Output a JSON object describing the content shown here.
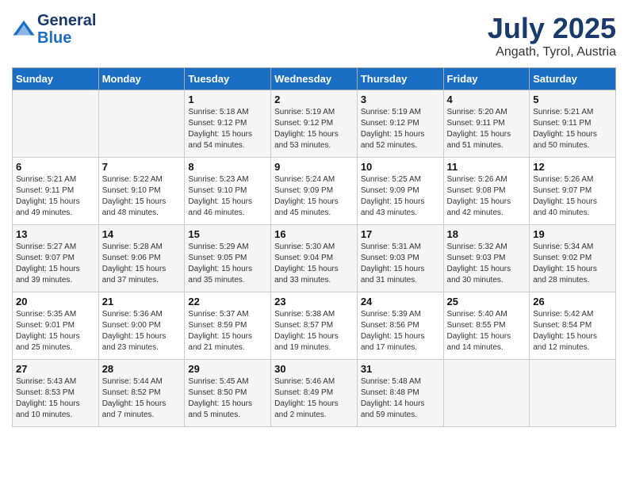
{
  "header": {
    "logo_line1": "General",
    "logo_line2": "Blue",
    "month": "July 2025",
    "location": "Angath, Tyrol, Austria"
  },
  "days_of_week": [
    "Sunday",
    "Monday",
    "Tuesday",
    "Wednesday",
    "Thursday",
    "Friday",
    "Saturday"
  ],
  "weeks": [
    [
      {
        "day": "",
        "info": ""
      },
      {
        "day": "",
        "info": ""
      },
      {
        "day": "1",
        "info": "Sunrise: 5:18 AM\nSunset: 9:12 PM\nDaylight: 15 hours and 54 minutes."
      },
      {
        "day": "2",
        "info": "Sunrise: 5:19 AM\nSunset: 9:12 PM\nDaylight: 15 hours and 53 minutes."
      },
      {
        "day": "3",
        "info": "Sunrise: 5:19 AM\nSunset: 9:12 PM\nDaylight: 15 hours and 52 minutes."
      },
      {
        "day": "4",
        "info": "Sunrise: 5:20 AM\nSunset: 9:11 PM\nDaylight: 15 hours and 51 minutes."
      },
      {
        "day": "5",
        "info": "Sunrise: 5:21 AM\nSunset: 9:11 PM\nDaylight: 15 hours and 50 minutes."
      }
    ],
    [
      {
        "day": "6",
        "info": "Sunrise: 5:21 AM\nSunset: 9:11 PM\nDaylight: 15 hours and 49 minutes."
      },
      {
        "day": "7",
        "info": "Sunrise: 5:22 AM\nSunset: 9:10 PM\nDaylight: 15 hours and 48 minutes."
      },
      {
        "day": "8",
        "info": "Sunrise: 5:23 AM\nSunset: 9:10 PM\nDaylight: 15 hours and 46 minutes."
      },
      {
        "day": "9",
        "info": "Sunrise: 5:24 AM\nSunset: 9:09 PM\nDaylight: 15 hours and 45 minutes."
      },
      {
        "day": "10",
        "info": "Sunrise: 5:25 AM\nSunset: 9:09 PM\nDaylight: 15 hours and 43 minutes."
      },
      {
        "day": "11",
        "info": "Sunrise: 5:26 AM\nSunset: 9:08 PM\nDaylight: 15 hours and 42 minutes."
      },
      {
        "day": "12",
        "info": "Sunrise: 5:26 AM\nSunset: 9:07 PM\nDaylight: 15 hours and 40 minutes."
      }
    ],
    [
      {
        "day": "13",
        "info": "Sunrise: 5:27 AM\nSunset: 9:07 PM\nDaylight: 15 hours and 39 minutes."
      },
      {
        "day": "14",
        "info": "Sunrise: 5:28 AM\nSunset: 9:06 PM\nDaylight: 15 hours and 37 minutes."
      },
      {
        "day": "15",
        "info": "Sunrise: 5:29 AM\nSunset: 9:05 PM\nDaylight: 15 hours and 35 minutes."
      },
      {
        "day": "16",
        "info": "Sunrise: 5:30 AM\nSunset: 9:04 PM\nDaylight: 15 hours and 33 minutes."
      },
      {
        "day": "17",
        "info": "Sunrise: 5:31 AM\nSunset: 9:03 PM\nDaylight: 15 hours and 31 minutes."
      },
      {
        "day": "18",
        "info": "Sunrise: 5:32 AM\nSunset: 9:03 PM\nDaylight: 15 hours and 30 minutes."
      },
      {
        "day": "19",
        "info": "Sunrise: 5:34 AM\nSunset: 9:02 PM\nDaylight: 15 hours and 28 minutes."
      }
    ],
    [
      {
        "day": "20",
        "info": "Sunrise: 5:35 AM\nSunset: 9:01 PM\nDaylight: 15 hours and 25 minutes."
      },
      {
        "day": "21",
        "info": "Sunrise: 5:36 AM\nSunset: 9:00 PM\nDaylight: 15 hours and 23 minutes."
      },
      {
        "day": "22",
        "info": "Sunrise: 5:37 AM\nSunset: 8:59 PM\nDaylight: 15 hours and 21 minutes."
      },
      {
        "day": "23",
        "info": "Sunrise: 5:38 AM\nSunset: 8:57 PM\nDaylight: 15 hours and 19 minutes."
      },
      {
        "day": "24",
        "info": "Sunrise: 5:39 AM\nSunset: 8:56 PM\nDaylight: 15 hours and 17 minutes."
      },
      {
        "day": "25",
        "info": "Sunrise: 5:40 AM\nSunset: 8:55 PM\nDaylight: 15 hours and 14 minutes."
      },
      {
        "day": "26",
        "info": "Sunrise: 5:42 AM\nSunset: 8:54 PM\nDaylight: 15 hours and 12 minutes."
      }
    ],
    [
      {
        "day": "27",
        "info": "Sunrise: 5:43 AM\nSunset: 8:53 PM\nDaylight: 15 hours and 10 minutes."
      },
      {
        "day": "28",
        "info": "Sunrise: 5:44 AM\nSunset: 8:52 PM\nDaylight: 15 hours and 7 minutes."
      },
      {
        "day": "29",
        "info": "Sunrise: 5:45 AM\nSunset: 8:50 PM\nDaylight: 15 hours and 5 minutes."
      },
      {
        "day": "30",
        "info": "Sunrise: 5:46 AM\nSunset: 8:49 PM\nDaylight: 15 hours and 2 minutes."
      },
      {
        "day": "31",
        "info": "Sunrise: 5:48 AM\nSunset: 8:48 PM\nDaylight: 14 hours and 59 minutes."
      },
      {
        "day": "",
        "info": ""
      },
      {
        "day": "",
        "info": ""
      }
    ]
  ]
}
